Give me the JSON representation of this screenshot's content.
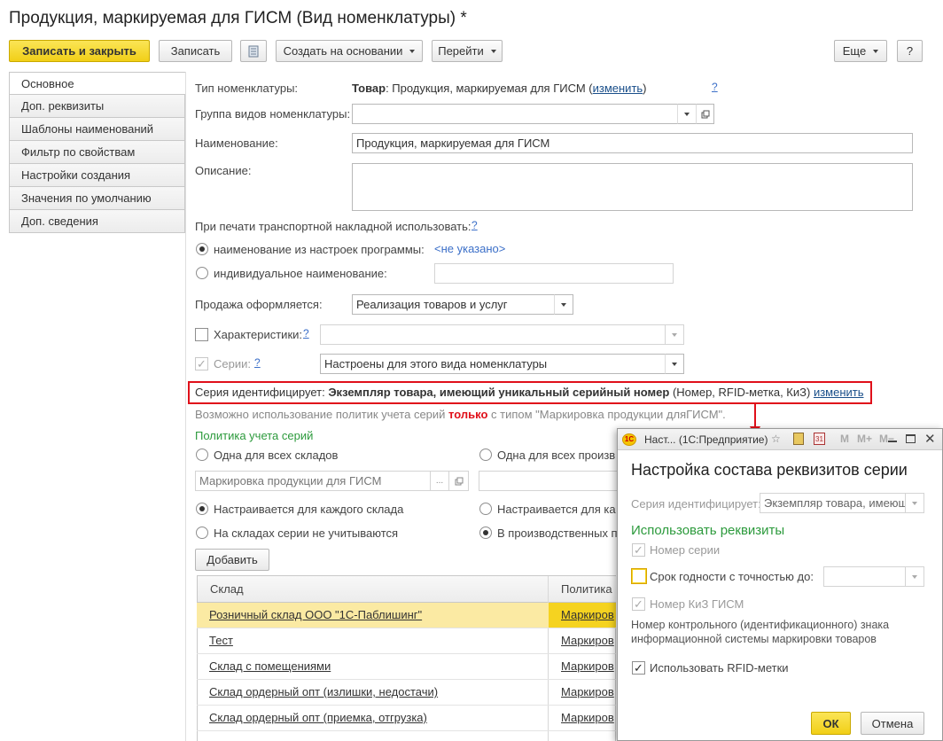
{
  "window_title": "Продукция, маркируемая для ГИСМ (Вид номенклатуры) *",
  "toolbar": {
    "save_close": "Записать и закрыть",
    "save": "Записать",
    "create_based": "Создать на основании",
    "goto": "Перейти",
    "more": "Еще",
    "help": "?"
  },
  "tabs": [
    "Основное",
    "Доп. реквизиты",
    "Шаблоны наименований",
    "Фильтр по свойствам",
    "Настройки создания",
    "Значения по умолчанию",
    "Доп. сведения"
  ],
  "form": {
    "type_label": "Тип номенклатуры:",
    "type_value_bold": "Товар",
    "type_value_rest": ": Продукция, маркируемая для ГИСМ (",
    "type_change": "изменить",
    "type_close": ")",
    "help_q": "?",
    "group_label": "Группа видов номенклатуры:",
    "group_value": "",
    "name_label": "Наименование:",
    "name_value": "Продукция, маркируемая для ГИСМ",
    "desc_label": "Описание:",
    "desc_value": "",
    "print_label": "При печати транспортной накладной использовать:",
    "radio_settings": "наименование из настроек программы:",
    "not_specified": "<не указано>",
    "radio_individual": "индивидуальное наименование:",
    "sale_label": "Продажа оформляется:",
    "sale_value": "Реализация товаров и услуг",
    "characteristics_label": "Характеристики:",
    "series_label": "Серии:",
    "series_value": "Настроены для этого вида номенклатуры",
    "series_ident_prefix": "Серия идентифицирует: ",
    "series_ident_bold": "Экземпляр товара, имеющий уникальный серийный номер",
    "series_ident_suffix": " (Номер, RFID-метка, КиЗ) ",
    "series_ident_change": "изменить",
    "policy_note_1": "Возможно использование политик учета серий ",
    "policy_note_only": "только",
    "policy_note_2": " с типом \"Маркировка продукции дляГИСМ\".",
    "policy_header": "Политика учета серий",
    "one_all_warehouses": "Одна для всех складов",
    "one_all_production": "Одна для всех произв",
    "policy_value": "Маркировка продукции для ГИСМ",
    "per_warehouse": "Настраивается для каждого склада",
    "per_warehouse_2": "Настраивается для ка",
    "not_tracked": "На складах серии не учитываются",
    "in_production": "В производственных п",
    "add_button": "Добавить",
    "col_warehouse": "Склад",
    "col_policy": "Политика",
    "rows": [
      {
        "warehouse": "Розничный склад ООО \"1С-Паблишинг\"",
        "policy": "Маркиров"
      },
      {
        "warehouse": "Тест",
        "policy": "Маркиров"
      },
      {
        "warehouse": "Склад с помещениями",
        "policy": "Маркиров"
      },
      {
        "warehouse": "Склад ордерный опт (излишки, недостачи)",
        "policy": "Маркиров"
      },
      {
        "warehouse": "Склад ордерный опт (приемка, отгрузка)",
        "policy": "Маркиров"
      }
    ]
  },
  "dialog": {
    "window_title": "Наст... (1С:Предприятие)",
    "heading": "Настройка состава реквизитов серии",
    "ident_label": "Серия идентифицирует:",
    "ident_value": "Экземпляр товара, имеющ",
    "use_header": "Использовать реквизиты",
    "series_number": "Номер серии",
    "expiry": "Срок годности с точностью до:",
    "kiz": "Номер КиЗ ГИСМ",
    "kiz_desc": "Номер контрольного (идентификационного) знака информационной системы маркировки товаров",
    "rfid": "Использовать RFID-метки",
    "ok": "ОК",
    "cancel": "Отмена"
  },
  "colors": {
    "accent_yellow": "#f5d320",
    "highlight_red": "#e0101a",
    "green": "#2c9a3c",
    "link": "#1a4f8a"
  }
}
